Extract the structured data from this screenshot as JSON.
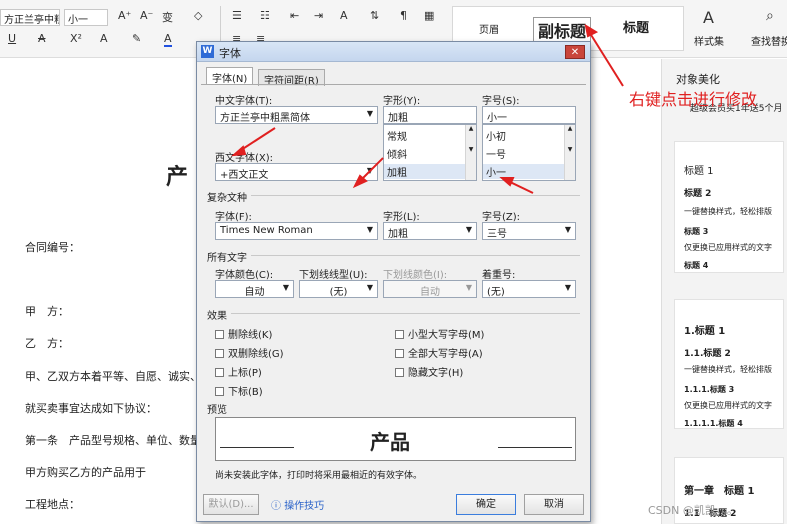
{
  "ribbon": {
    "font_name": "方正兰亭中粗黑简体",
    "font_size": "小一",
    "styles": [
      "页眉",
      "副标题",
      "标题"
    ],
    "style_set_label": "样式集",
    "find_label": "查找替换",
    "doc_beautify": "对象美化",
    "super_member": "超级会员买1年送5个月"
  },
  "document": {
    "title_fragment": "产",
    "lines": [
      "合同编号：",
      "甲　方：",
      "乙　方：",
      "甲、乙双方本着平等、自愿、诚实、",
      "就买卖事宜达成如下协议：",
      "第一条　产品型号规格、单位、数量",
      "甲方购买乙方的产品用于",
      "工程地点："
    ]
  },
  "pane": {
    "card1": [
      "标题 1",
      "标题 2",
      "一键替换样式，轻松排版",
      "标题 3",
      "仅更换已应用样式的文字",
      "标题 4"
    ],
    "card2": [
      "1.标题 1",
      "1.1.标题 2",
      "一键替换样式，轻松排版",
      "1.1.1.标题 3",
      "仅更换已应用样式的文字",
      "1.1.1.1.标题 4"
    ],
    "card3": [
      "第一章　标题 1",
      "1.1　标题 2"
    ]
  },
  "dialog": {
    "title": "字体",
    "tabs": [
      "字体(N)",
      "字符间距(R)"
    ],
    "cn_font_label": "中文字体(T):",
    "cn_font_value": "方正兰亭中粗黑简体",
    "style_label": "字形(Y):",
    "style_value": "加粗",
    "style_options": [
      "常规",
      "倾斜",
      "加粗"
    ],
    "size_label": "字号(S):",
    "size_value": "小一",
    "size_options": [
      "小初",
      "一号",
      "小一"
    ],
    "west_font_label": "西文字体(X):",
    "west_font_value": "+西文正文",
    "complex_group": "复杂文种",
    "complex_font_label": "字体(F):",
    "complex_font_value": "Times New Roman",
    "complex_style_label": "字形(L):",
    "complex_style_value": "加粗",
    "complex_size_label": "字号(Z):",
    "complex_size_value": "三号",
    "all_text_group": "所有文字",
    "font_color_label": "字体颜色(C):",
    "font_color_value": "自动",
    "underline_label": "下划线线型(U):",
    "underline_value": "(无)",
    "underline_color_label": "下划线颜色(I):",
    "underline_color_value": "自动",
    "emphasis_label": "着重号:",
    "emphasis_value": "(无)",
    "effects_group": "效果",
    "effects_left": [
      "删除线(K)",
      "双删除线(G)",
      "上标(P)",
      "下标(B)"
    ],
    "effects_right": [
      "小型大写字母(M)",
      "全部大写字母(A)",
      "隐藏文字(H)"
    ],
    "preview_group": "预览",
    "preview_text": "产品",
    "preview_note": "尚未安装此字体，打印时将采用最相近的有效字体。",
    "default_button": "默认(D)...",
    "tips_link": "操作技巧",
    "ok_button": "确定",
    "cancel_button": "取消"
  },
  "annotation": "右键点击进行修改",
  "watermark": "CSDN @凯凯。。。",
  "colors": {
    "annotation_red": "#e02020",
    "dialog_bg": "#f0f0f0",
    "primary_button": "#3b7ddd"
  }
}
